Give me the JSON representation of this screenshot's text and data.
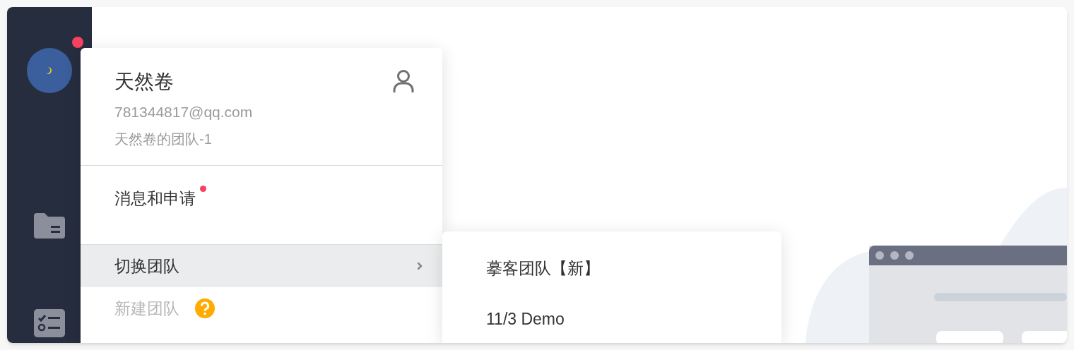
{
  "sidebar": {
    "avatar": {
      "has_notification": true
    },
    "items": [
      {
        "kind": "folder"
      },
      {
        "kind": "tasks"
      }
    ]
  },
  "account_menu": {
    "name": "天然卷",
    "email": "781344817@qq.com",
    "team": "天然卷的团队-1",
    "items": [
      {
        "kind": "link",
        "label": "消息和申请",
        "unread": true,
        "selected": false,
        "disabled": false,
        "divider_after": true
      },
      {
        "kind": "submenu",
        "label": "切换团队",
        "unread": false,
        "selected": true,
        "disabled": false,
        "divider_after": false
      },
      {
        "kind": "help",
        "label": "新建团队",
        "unread": false,
        "selected": false,
        "disabled": true,
        "divider_after": false
      }
    ]
  },
  "team_submenu": {
    "items": [
      {
        "label": "摹客团队【新】"
      },
      {
        "label": "11/3 Demo"
      }
    ]
  }
}
